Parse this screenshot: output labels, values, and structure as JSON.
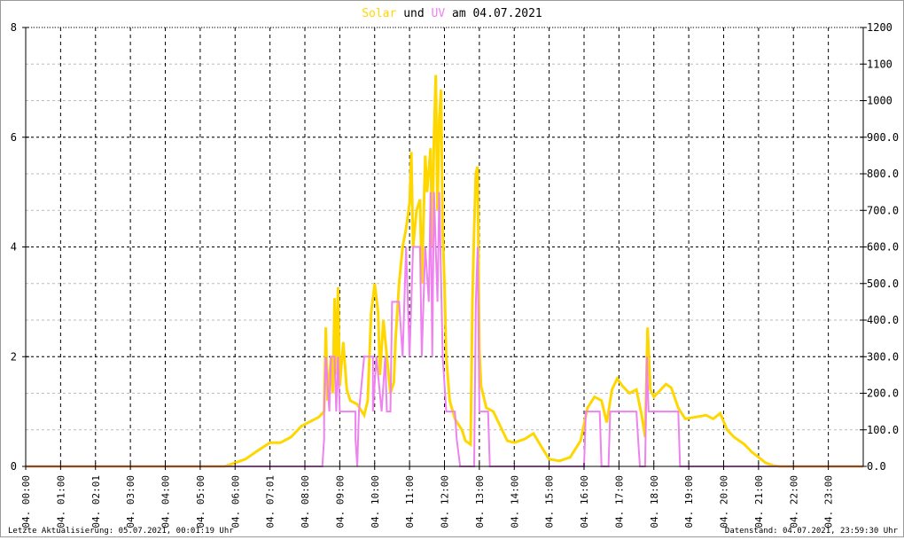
{
  "chart_data": {
    "type": "line",
    "title": {
      "part1": "Solar",
      "part2": " und ",
      "part3": "UV",
      "part4": " am 04.07.2021"
    },
    "colors": {
      "solar": "#ffd700",
      "uv": "#ee82ee",
      "grid": "#000000",
      "minor_grid": "#bbbbbb"
    },
    "x_range_hours": [
      0,
      24
    ],
    "x_tick_labels": [
      "04. 00:00",
      "04. 01:00",
      "04. 02:01",
      "04. 03:00",
      "04. 04:00",
      "04. 05:00",
      "04. 06:00",
      "04. 07:01",
      "04. 08:00",
      "04. 09:00",
      "04. 10:00",
      "04. 11:00",
      "04. 12:00",
      "04. 13:00",
      "04. 14:00",
      "04. 15:00",
      "04. 16:00",
      "04. 17:00",
      "04. 18:00",
      "04. 19:00",
      "04. 20:00",
      "04. 21:00",
      "04. 22:00",
      "04. 23:00"
    ],
    "y_left": {
      "range": [
        0,
        8
      ],
      "ticks": [
        "0",
        "2",
        "4",
        "6",
        "8"
      ]
    },
    "y_right": {
      "range": [
        0,
        1200
      ],
      "ticks": [
        "0.0",
        "100.0",
        "200.0",
        "300.0",
        "400.0",
        "500.0",
        "600.0",
        "700.0",
        "800.0",
        "900.0",
        "1000",
        "1100",
        "1200"
      ]
    },
    "series": [
      {
        "name": "Solar",
        "axis": "right",
        "points": [
          [
            0,
            0
          ],
          [
            5.7,
            0
          ],
          [
            6.0,
            10
          ],
          [
            6.3,
            20
          ],
          [
            6.6,
            40
          ],
          [
            7.0,
            65
          ],
          [
            7.3,
            65
          ],
          [
            7.6,
            80
          ],
          [
            7.9,
            110
          ],
          [
            8.2,
            125
          ],
          [
            8.4,
            135
          ],
          [
            8.55,
            150
          ],
          [
            8.6,
            380
          ],
          [
            8.65,
            180
          ],
          [
            8.75,
            300
          ],
          [
            8.8,
            200
          ],
          [
            8.85,
            460
          ],
          [
            8.9,
            250
          ],
          [
            8.95,
            490
          ],
          [
            9.0,
            220
          ],
          [
            9.1,
            340
          ],
          [
            9.2,
            210
          ],
          [
            9.3,
            180
          ],
          [
            9.5,
            170
          ],
          [
            9.7,
            140
          ],
          [
            9.8,
            180
          ],
          [
            9.9,
            420
          ],
          [
            10.0,
            500
          ],
          [
            10.1,
            420
          ],
          [
            10.15,
            250
          ],
          [
            10.25,
            400
          ],
          [
            10.35,
            300
          ],
          [
            10.45,
            200
          ],
          [
            10.55,
            230
          ],
          [
            10.6,
            350
          ],
          [
            10.7,
            500
          ],
          [
            10.8,
            600
          ],
          [
            10.9,
            650
          ],
          [
            11.0,
            720
          ],
          [
            11.05,
            860
          ],
          [
            11.1,
            600
          ],
          [
            11.2,
            700
          ],
          [
            11.3,
            730
          ],
          [
            11.35,
            500
          ],
          [
            11.45,
            850
          ],
          [
            11.5,
            750
          ],
          [
            11.6,
            870
          ],
          [
            11.65,
            600
          ],
          [
            11.7,
            900
          ],
          [
            11.75,
            1070
          ],
          [
            11.8,
            700
          ],
          [
            11.85,
            950
          ],
          [
            11.9,
            1030
          ],
          [
            11.95,
            650
          ],
          [
            12.0,
            500
          ],
          [
            12.05,
            300
          ],
          [
            12.15,
            180
          ],
          [
            12.3,
            130
          ],
          [
            12.5,
            100
          ],
          [
            12.6,
            70
          ],
          [
            12.75,
            60
          ],
          [
            12.8,
            450
          ],
          [
            12.85,
            650
          ],
          [
            12.9,
            800
          ],
          [
            12.95,
            820
          ],
          [
            13.0,
            320
          ],
          [
            13.05,
            220
          ],
          [
            13.2,
            160
          ],
          [
            13.4,
            150
          ],
          [
            13.6,
            110
          ],
          [
            13.8,
            70
          ],
          [
            14.0,
            65
          ],
          [
            14.3,
            75
          ],
          [
            14.55,
            90
          ],
          [
            14.8,
            50
          ],
          [
            15.0,
            20
          ],
          [
            15.3,
            15
          ],
          [
            15.6,
            25
          ],
          [
            15.9,
            70
          ],
          [
            16.1,
            160
          ],
          [
            16.3,
            190
          ],
          [
            16.5,
            180
          ],
          [
            16.65,
            120
          ],
          [
            16.8,
            210
          ],
          [
            16.95,
            240
          ],
          [
            17.1,
            220
          ],
          [
            17.3,
            200
          ],
          [
            17.5,
            210
          ],
          [
            17.65,
            140
          ],
          [
            17.75,
            80
          ],
          [
            17.82,
            380
          ],
          [
            17.9,
            210
          ],
          [
            18.0,
            190
          ],
          [
            18.2,
            210
          ],
          [
            18.35,
            225
          ],
          [
            18.5,
            215
          ],
          [
            18.7,
            160
          ],
          [
            18.9,
            130
          ],
          [
            19.2,
            135
          ],
          [
            19.5,
            140
          ],
          [
            19.7,
            130
          ],
          [
            19.9,
            145
          ],
          [
            20.1,
            100
          ],
          [
            20.3,
            80
          ],
          [
            20.6,
            60
          ],
          [
            20.8,
            40
          ],
          [
            21.0,
            25
          ],
          [
            21.2,
            10
          ],
          [
            21.4,
            3
          ],
          [
            21.6,
            0
          ],
          [
            24,
            0
          ]
        ]
      },
      {
        "name": "UV",
        "axis": "left",
        "points": [
          [
            0,
            0
          ],
          [
            8.5,
            0
          ],
          [
            8.55,
            0.5
          ],
          [
            8.55,
            1
          ],
          [
            8.6,
            2
          ],
          [
            8.7,
            1
          ],
          [
            8.75,
            2
          ],
          [
            8.85,
            2
          ],
          [
            8.9,
            1
          ],
          [
            8.95,
            2
          ],
          [
            9.0,
            1
          ],
          [
            9.45,
            1
          ],
          [
            9.45,
            0.5
          ],
          [
            9.5,
            0
          ],
          [
            9.55,
            1
          ],
          [
            9.7,
            2
          ],
          [
            9.95,
            2
          ],
          [
            9.95,
            1
          ],
          [
            10.05,
            2
          ],
          [
            10.2,
            1
          ],
          [
            10.3,
            2
          ],
          [
            10.35,
            1
          ],
          [
            10.45,
            1
          ],
          [
            10.5,
            3
          ],
          [
            10.7,
            3
          ],
          [
            10.8,
            2
          ],
          [
            10.9,
            4
          ],
          [
            11.0,
            2
          ],
          [
            11.1,
            4
          ],
          [
            11.3,
            4
          ],
          [
            11.35,
            2
          ],
          [
            11.45,
            4
          ],
          [
            11.55,
            3
          ],
          [
            11.6,
            5
          ],
          [
            11.65,
            2
          ],
          [
            11.7,
            5
          ],
          [
            11.8,
            3
          ],
          [
            11.85,
            5
          ],
          [
            11.95,
            2
          ],
          [
            12.05,
            1
          ],
          [
            12.3,
            1
          ],
          [
            12.35,
            0.5
          ],
          [
            12.45,
            0
          ],
          [
            12.85,
            0
          ],
          [
            12.9,
            3
          ],
          [
            12.95,
            4
          ],
          [
            13.0,
            1
          ],
          [
            13.25,
            1
          ],
          [
            13.3,
            0
          ],
          [
            16.0,
            0
          ],
          [
            16.05,
            1
          ],
          [
            16.45,
            1
          ],
          [
            16.5,
            0
          ],
          [
            16.7,
            0
          ],
          [
            16.75,
            1
          ],
          [
            17.5,
            1
          ],
          [
            17.55,
            0.5
          ],
          [
            17.6,
            0
          ],
          [
            17.75,
            0
          ],
          [
            17.8,
            2
          ],
          [
            17.85,
            1
          ],
          [
            18.7,
            1
          ],
          [
            18.75,
            0
          ],
          [
            24,
            0
          ]
        ]
      }
    ]
  },
  "footer": {
    "left": "Letzte Aktualisierung: 05.07.2021, 00:01:19 Uhr",
    "right": "Datenstand: 04.07.2021, 23:59:30 Uhr"
  }
}
